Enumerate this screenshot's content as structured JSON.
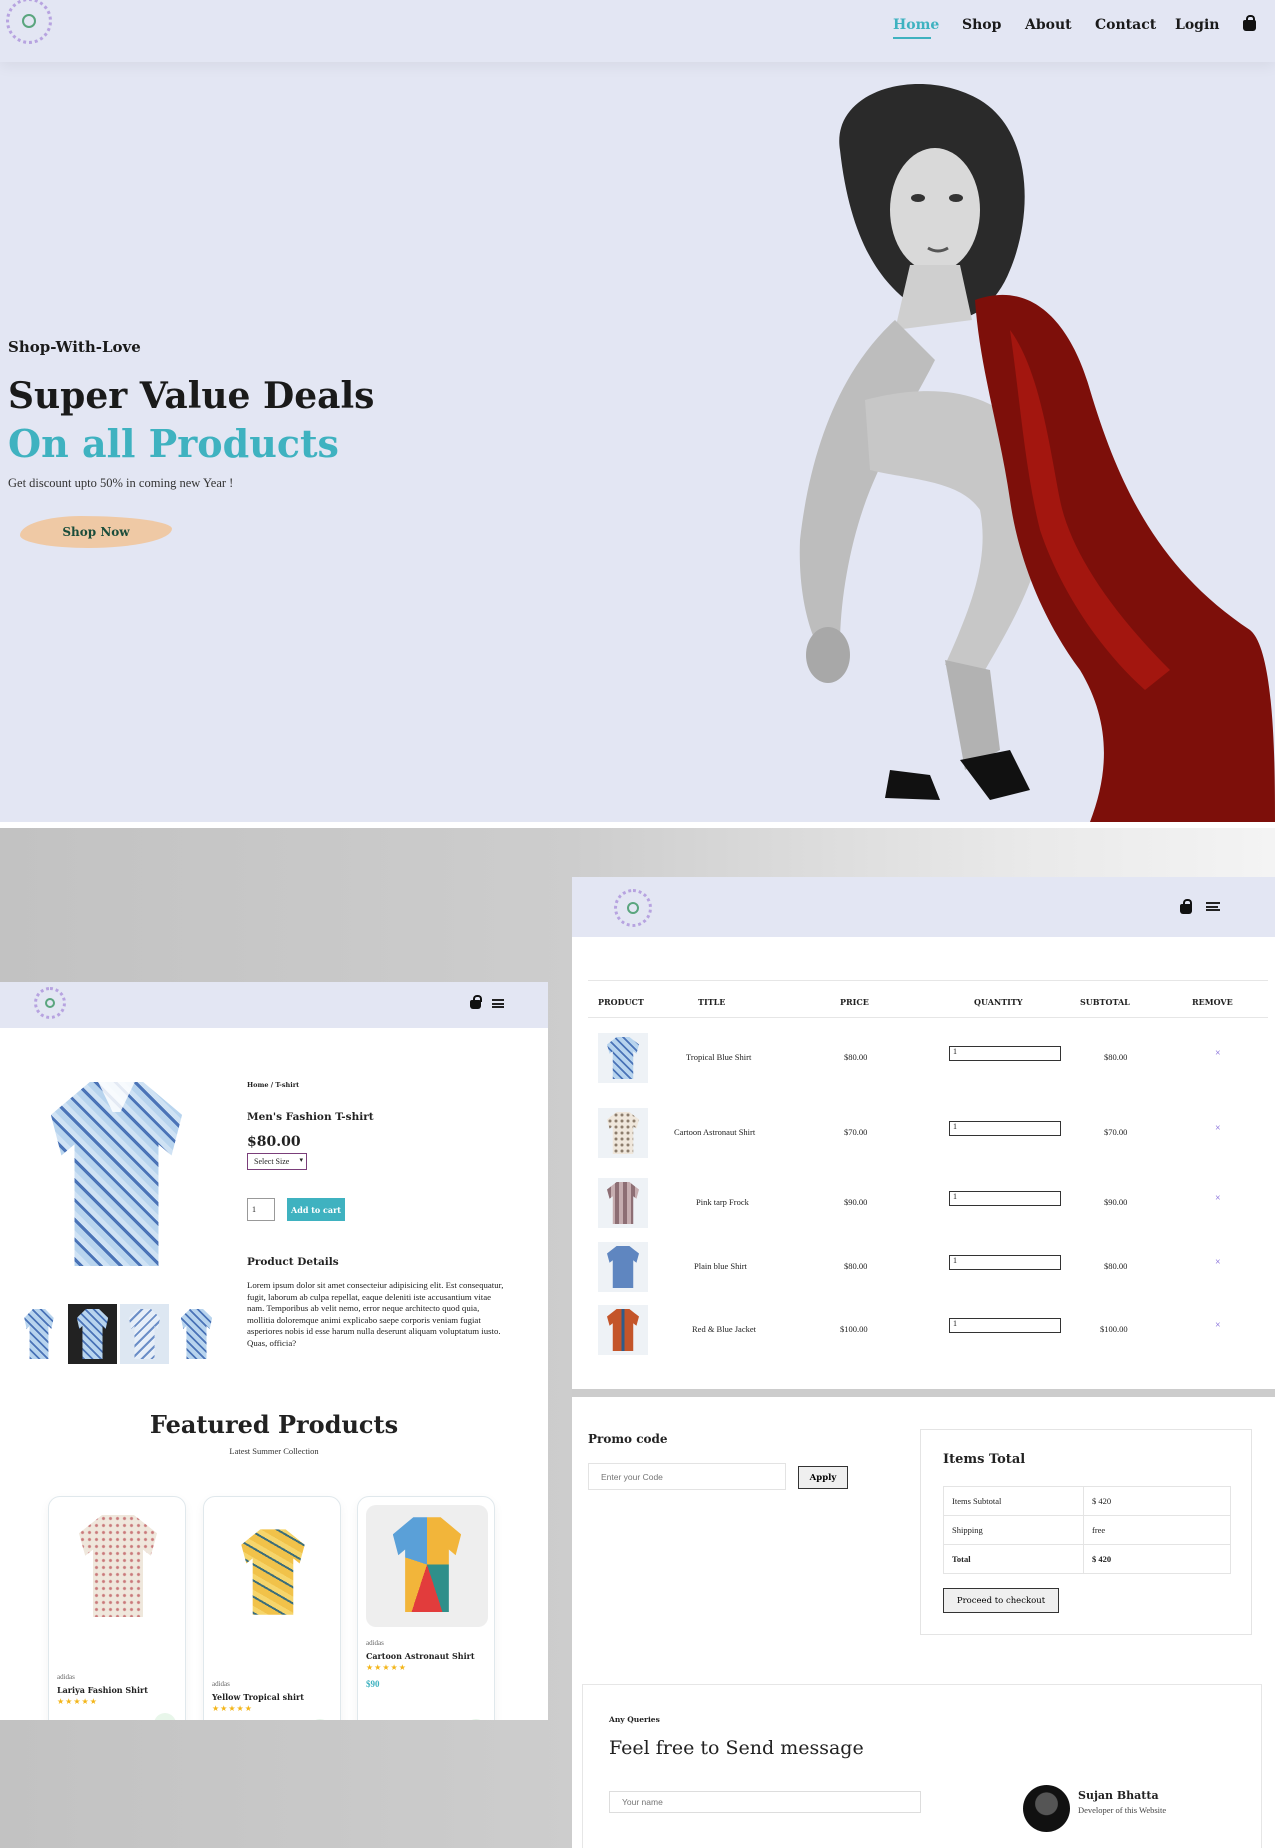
{
  "hero": {
    "nav": {
      "links": [
        "Home",
        "Shop",
        "About",
        "Contact",
        "Login"
      ],
      "active": "Home"
    },
    "subtitle": "Shop-With-Love",
    "heading": "Super Value Deals",
    "heading_accent": "On all Products",
    "text": "Get discount upto 50% in coming new Year !",
    "cta": "Shop Now",
    "accent_color": "#3fb2c0",
    "background_color": "#e3e6f3"
  },
  "product_page": {
    "breadcrumb": "Home / T-shirt",
    "title": "Men's Fashion T-shirt",
    "price": "$80.00",
    "size_select": "Select Size",
    "quantity": "1",
    "add_to_cart": "Add to cart",
    "details_heading": "Product Details",
    "details_text": "Lorem ipsum dolor sit amet consecteiur adipisicing elit. Est consequatur, fugit, laborum ab culpa repellat, eaque deleniti iste accusantium vitae nam. Temporibus ab velit nemo, error neque architecto quod quia, mollitia doloremque animi explicabo saepe corporis veniam fugiat asperiores nobis id esse harum nulla deserunt aliquam voluptatum iusto. Quas, officia?",
    "featured_heading": "Featured Products",
    "featured_subheading": "Latest Summer Collection",
    "featured": [
      {
        "brand": "adidas",
        "name": "Lariya Fashion Shirt",
        "stars": "★★★★★",
        "price": ""
      },
      {
        "brand": "adidas",
        "name": "Yellow Tropical shirt",
        "stars": "★★★★★",
        "price": ""
      },
      {
        "brand": "adidas",
        "name": "Cartoon Astronaut Shirt",
        "stars": "★★★★★",
        "price": "$90"
      }
    ]
  },
  "cart_page": {
    "columns": [
      "PRODUCT",
      "TITLE",
      "PRICE",
      "QUANTITY",
      "SUBTOTAL",
      "REMOVE"
    ],
    "rows": [
      {
        "title": "Tropical Blue Shirt",
        "price": "$80.00",
        "qty": "1",
        "subtotal": "$80.00",
        "remove": "×"
      },
      {
        "title": "Cartoon Astronaut Shirt",
        "price": "$70.00",
        "qty": "1",
        "subtotal": "$70.00",
        "remove": "×"
      },
      {
        "title": "Pink tarp Frock",
        "price": "$90.00",
        "qty": "1",
        "subtotal": "$90.00",
        "remove": "×"
      },
      {
        "title": "Plain blue Shirt",
        "price": "$80.00",
        "qty": "1",
        "subtotal": "$80.00",
        "remove": "×"
      },
      {
        "title": "Red & Blue Jacket",
        "price": "$100.00",
        "qty": "1",
        "subtotal": "$100.00",
        "remove": "×"
      }
    ],
    "promo": {
      "heading": "Promo code",
      "placeholder": "Enter your Code",
      "apply": "Apply"
    },
    "totals": {
      "heading": "Items Total",
      "rows": [
        {
          "label": "Items Subtotal",
          "value": "$ 420"
        },
        {
          "label": "Shipping",
          "value": "free"
        },
        {
          "label": "Total",
          "value": "$ 420"
        }
      ],
      "checkout": "Proceed to checkout"
    },
    "contact": {
      "eyebrow": "Any Queries",
      "heading": "Feel free to Send message",
      "name_placeholder": "Your name",
      "person_name": "Sujan Bhatta",
      "person_role": "Developer of this Website"
    }
  }
}
